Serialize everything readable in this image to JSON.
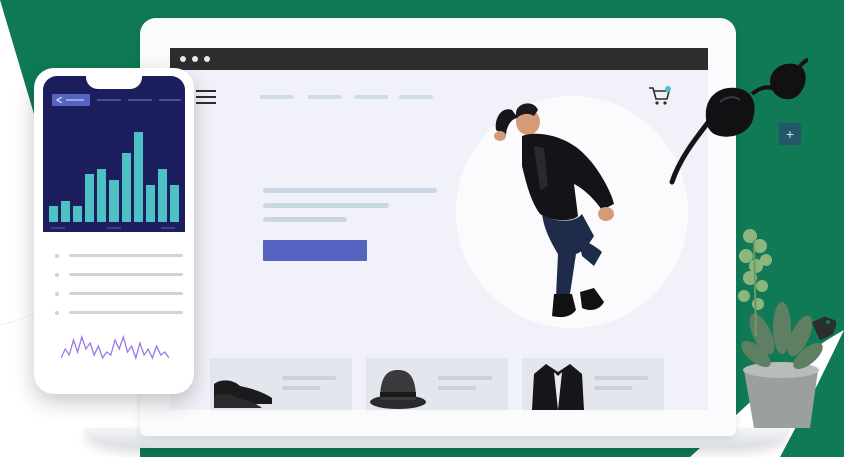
{
  "colors": {
    "background_green": "#0f7a55",
    "accent_indigo": "#5563c1",
    "phone_header": "#1d1e5e",
    "chart_bars": "#4ec1c4",
    "sparkline": "#9a78e6",
    "browser_bar": "#2b2d2f"
  },
  "laptop": {
    "browser_dots": [
      "dot",
      "dot",
      "dot"
    ],
    "header": {
      "menu_icon": "hamburger-menu-icon",
      "cart_icon": "shopping-cart-icon",
      "nav_item_count": 4
    },
    "hero": {
      "cta_color": "#5563c1"
    },
    "products": [
      {
        "icon": "shoes-icon"
      },
      {
        "icon": "hat-icon"
      },
      {
        "icon": "jacket-icon"
      }
    ]
  },
  "phone": {
    "back_icon": "back-arrow-icon",
    "tab_count": 3,
    "chart_data": {
      "type": "bar",
      "values": [
        3,
        4,
        3,
        9,
        10,
        8,
        13,
        17,
        7,
        10,
        7
      ]
    },
    "list_item_count": 4,
    "sparkline": {
      "type": "line",
      "values": [
        2,
        5,
        3,
        8,
        4,
        9,
        5,
        7,
        3,
        6,
        2,
        4,
        3,
        8,
        5,
        9,
        4,
        6,
        2,
        7,
        3,
        5,
        2,
        6,
        3,
        4,
        2
      ]
    }
  },
  "decor": {
    "sunglasses_icon": "sunglasses-icon",
    "plant_icon": "succulent-plant-icon",
    "tag_icon": "price-tag-icon",
    "plus_icon": "plus-icon",
    "model_image": "jumping-man-image"
  }
}
